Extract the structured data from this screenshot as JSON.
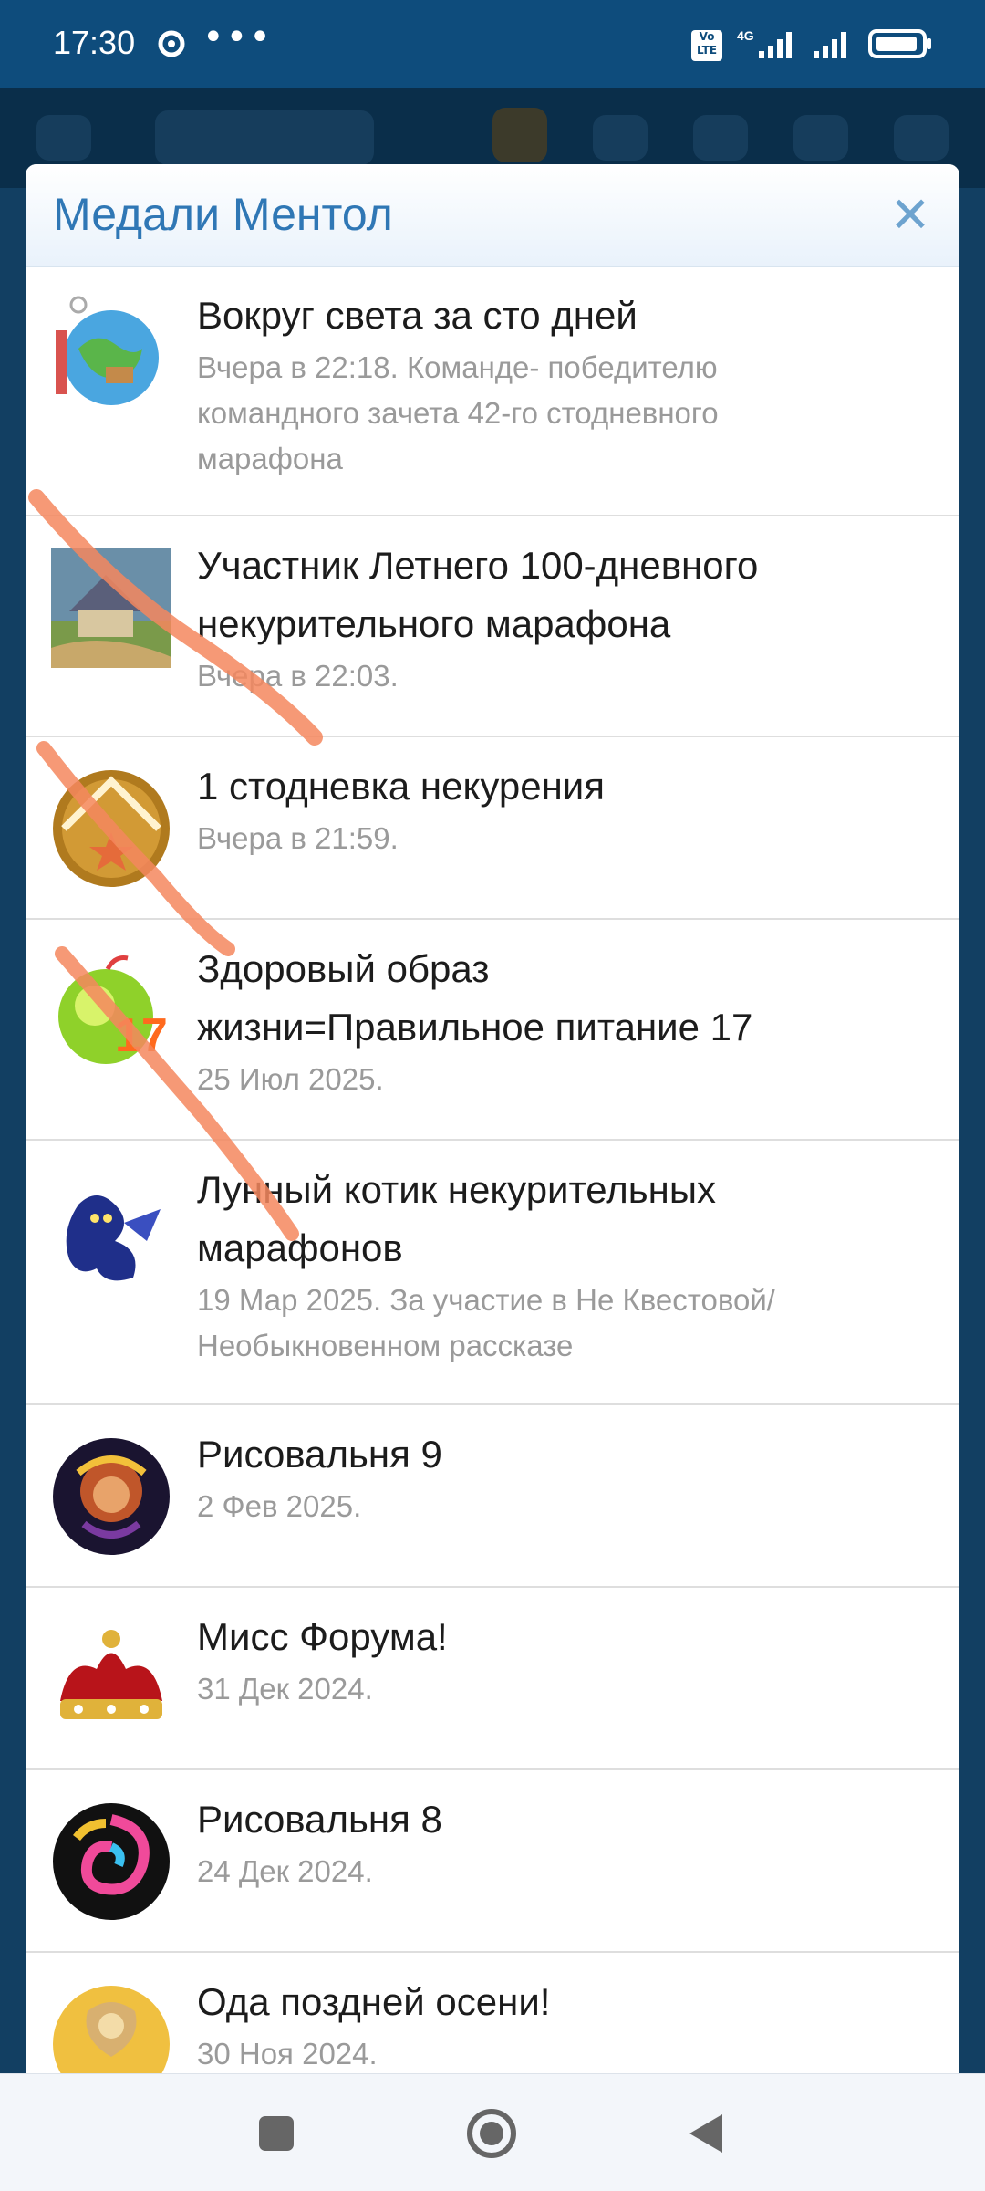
{
  "status_bar": {
    "time": "17:30",
    "dots": "•••",
    "network": "4G",
    "volte": "Vo LTE"
  },
  "modal": {
    "title": "Медали Ментол",
    "close_icon": "close-icon"
  },
  "medals": [
    {
      "title_lines": [
        "Вокруг света за сто дней"
      ],
      "sub_lines": [
        "Вчера в 22:18. Команде- победителю",
        "командного зачета 42-го стодневного",
        "марафона"
      ],
      "icon": "globe-medal"
    },
    {
      "title_lines": [
        "Участник Летнего 100-дневного",
        "некурительного марафона"
      ],
      "sub_lines": [
        "Вчера в 22:03."
      ],
      "icon": "house-painting-medal"
    },
    {
      "title_lines": [
        "1 стодневка некурения"
      ],
      "sub_lines": [
        "Вчера в 21:59."
      ],
      "icon": "gold-star-medal"
    },
    {
      "title_lines": [
        "Здоровый образ",
        "жизни=Правильное питание 17"
      ],
      "sub_lines": [
        "25 Июл 2025."
      ],
      "icon": "green-apple-medal"
    },
    {
      "title_lines": [
        "Лунный котик некурительных",
        "марафонов"
      ],
      "sub_lines": [
        "19 Мар 2025. За участие в Не Квестовой/",
        "Необыкновенном рассказе"
      ],
      "icon": "moon-cat-medal"
    },
    {
      "title_lines": [
        "Рисовальня 9"
      ],
      "sub_lines": [
        "2 Фев 2025."
      ],
      "icon": "painted-portrait-medal"
    },
    {
      "title_lines": [
        "Мисс Форума!"
      ],
      "sub_lines": [
        "31 Дек 2024."
      ],
      "icon": "crown-medal"
    },
    {
      "title_lines": [
        "Рисовальня 8"
      ],
      "sub_lines": [
        "24 Дек 2024."
      ],
      "icon": "color-swirl-medal"
    },
    {
      "title_lines": [
        "Ода поздней осени!"
      ],
      "sub_lines": [
        "30 Ноя 2024."
      ],
      "icon": "angel-medal"
    }
  ],
  "colors": {
    "title_blue": "#2f77b5",
    "stroke_orange": "#f4875e"
  }
}
